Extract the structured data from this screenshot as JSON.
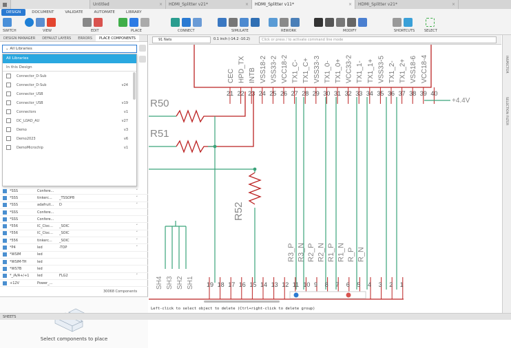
{
  "tabs": [
    {
      "label": "",
      "active": false
    },
    {
      "label": "Untitled",
      "active": false
    },
    {
      "label": "HDMI_Splitter v21*",
      "active": false
    },
    {
      "label": "HDMI_Splitter v11*",
      "active": true
    },
    {
      "label": "HDMI_Splitter v21*",
      "active": false
    }
  ],
  "menu": [
    "DESIGN",
    "DOCUMENT",
    "VALIDATE",
    "AUTOMATE",
    "LIBRARY"
  ],
  "toolbar": {
    "groups": [
      "SWITCH",
      "VIEW",
      "EDIT",
      "PLACE",
      "CONNECT",
      "SIMULATE",
      "REWORK",
      "MODIFY",
      "SHORTCUTS",
      "SELECT"
    ]
  },
  "panel": {
    "tabs": [
      "DESIGN MANAGER",
      "DEFAULT LAYERS",
      "ERRORS",
      "PLACE COMPONENTS"
    ],
    "search": "All Libraries",
    "dropdown": {
      "all": "All Libraries",
      "in_design": "In this Design",
      "rows": [
        {
          "name": "Connector_D-Sub",
          "ver": ""
        },
        {
          "name": "Connector_D-Sub",
          "ver": "v24"
        },
        {
          "name": "Connector_USB",
          "ver": ""
        },
        {
          "name": "Connector_USB",
          "ver": "v19"
        },
        {
          "name": "Connectors",
          "ver": "v1"
        },
        {
          "name": "DC_LOAD_AU",
          "ver": "v27"
        },
        {
          "name": "Demo",
          "ver": "v3"
        },
        {
          "name": "Demo2023",
          "ver": "v6"
        },
        {
          "name": "DemoMicrochip",
          "ver": "v1"
        }
      ]
    },
    "list": [
      {
        "c1": "*SSS",
        "c2": "Confere...",
        "c3": "",
        "chev": "˅"
      },
      {
        "c1": "*SSS",
        "c2": "tinkerc...",
        "c3": "_TSSOP8",
        "chev": "˅"
      },
      {
        "c1": "*SSS",
        "c2": "adafruit...",
        "c3": "D",
        "chev": "˅"
      },
      {
        "c1": "*SSS",
        "c2": "Confere...",
        "c3": "",
        "chev": ""
      },
      {
        "c1": "*SSS",
        "c2": "Confere...",
        "c3": "",
        "chev": ""
      },
      {
        "c1": "*556",
        "c2": "IC_Cloc...",
        "c3": "_SOIC",
        "chev": "˅"
      },
      {
        "c1": "*556",
        "c2": "IC_Cloc...",
        "c3": "_SOIC",
        "chev": "˅"
      },
      {
        "c1": "*556",
        "c2": "tinkerc...",
        "c3": "_SOIC",
        "chev": "˅"
      },
      {
        "c1": "*P4",
        "c2": "led",
        "c3": "-TOP",
        "chev": "˅"
      },
      {
        "c1": "*WSIM",
        "c2": "led",
        "c3": "",
        "chev": ""
      },
      {
        "c1": "*WSIM-TH",
        "c2": "led",
        "c3": "",
        "chev": ""
      },
      {
        "c1": "*WS7B",
        "c2": "led",
        "c3": "",
        "chev": ""
      },
      {
        "c1": "*_/A/A+/+1",
        "c2": "led",
        "c3": "FLG2",
        "chev": "˅"
      },
      {
        "c1": "+12V",
        "c2": "Power_...",
        "c3": "",
        "chev": ""
      }
    ],
    "count": "30068 Components",
    "preview_text": "Select components to place"
  },
  "canvas": {
    "net": "91 Nets",
    "coord": "0.1 inch (-14.2 -10.2)",
    "cmd_placeholder": "Click or press / to activate command line mode",
    "status": "Left-click to select object to delete (Ctrl+right-click to delete group)",
    "power": "+4.4V",
    "r50": "R50",
    "r51": "R51",
    "r52": "R52",
    "top_pin_numbers": [
      "21",
      "22",
      "23",
      "24",
      "25",
      "26",
      "27",
      "28",
      "29",
      "30",
      "31",
      "32",
      "33",
      "34",
      "35",
      "36",
      "37",
      "38",
      "39",
      "40"
    ],
    "top_pin_names": [
      "CEC",
      "HPD_TX",
      "INTB",
      "VSS18-2",
      "VSS33-2",
      "VCC18-2",
      "TX1_C-",
      "TX1_C+",
      "VSS33-3",
      "TX1_0-",
      "TX1_0+",
      "VCC33-2",
      "TX1_1-",
      "TX1_1+",
      "VSS33-5",
      "TX1_2-",
      "TX1_2+",
      "VSS18-6",
      "VCC18-4"
    ],
    "bottom_pin_numbers": [
      "19",
      "18",
      "17",
      "16",
      "15",
      "14",
      "13",
      "12",
      "11",
      "10",
      "9",
      "8",
      "7",
      "6",
      "5",
      "4",
      "3",
      "2",
      "1"
    ],
    "sh_labels": [
      "SH4",
      "SH3",
      "SH2",
      "SH1"
    ],
    "net_labels": [
      "R3_P",
      "R3_N",
      "R2_P",
      "R2_N",
      "R1_P",
      "R1_N",
      "R_P",
      "R_N"
    ]
  },
  "rightbar": [
    "INSPECTOR",
    "SELECTION FILTER"
  ],
  "bottom": "SHEETS"
}
